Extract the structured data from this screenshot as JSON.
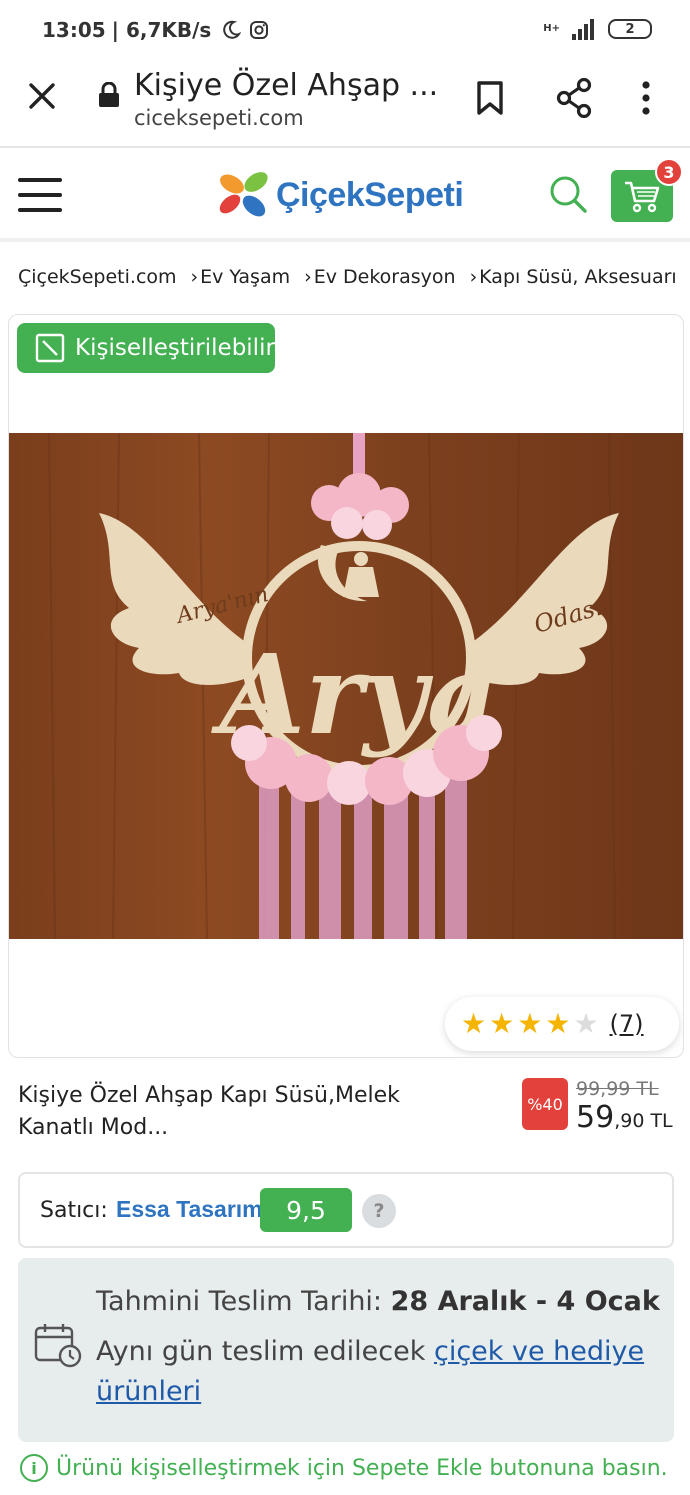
{
  "status_bar": {
    "time": "13:05",
    "speed": "| 6,7KB/s",
    "network": "H+",
    "battery": "2"
  },
  "browser": {
    "title": "Kişiye Özel Ahşap ...",
    "domain": "ciceksepeti.com"
  },
  "header": {
    "logo_text": "ÇiçekSepeti",
    "cart_count": "3"
  },
  "breadcrumb": [
    "ÇiçekSepeti.com",
    "Ev Yaşam",
    "Ev Dekorasyon",
    "Kapı Süsü, Aksesuarı"
  ],
  "product": {
    "badge": "Kişiselleştirilebilir",
    "image_texts": {
      "left_wing": "Arya'nın",
      "center": "Arya",
      "right_wing": "Odası"
    },
    "rating": 4,
    "rating_max": 5,
    "review_count": "(7)",
    "title": "Kişiye Özel Ahşap Kapı Süsü,Melek Kanatlı Mod...",
    "discount": "%40",
    "old_price": "99,99 TL",
    "price_whole": "59",
    "price_fraction": ",90 TL"
  },
  "seller": {
    "label": "Satıcı:",
    "name": "Essa Tasarım",
    "score": "9,5",
    "help": "?"
  },
  "delivery": {
    "label": "Tahmini Teslim Tarihi:",
    "date": "28 Aralık - 4 Ocak",
    "text": "Aynı gün teslim edilecek",
    "link": "çiçek ve hediye ürünleri"
  },
  "info": {
    "icon": "i",
    "text": "Ürünü kişiselleştirmek için Sepete Ekle butonuna basın."
  },
  "colors": {
    "brand_blue": "#2f74c0",
    "brand_green": "#43b052",
    "discount_red": "#e2423b",
    "star_yellow": "#f5b400"
  }
}
